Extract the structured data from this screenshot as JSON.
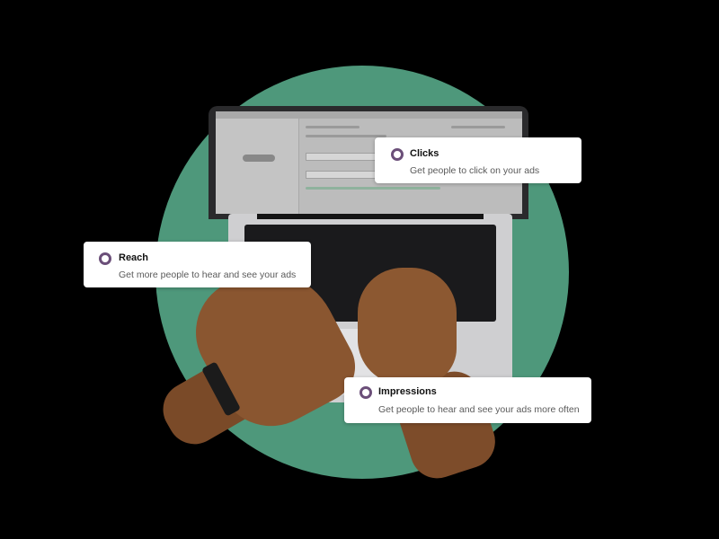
{
  "options": [
    {
      "title": "Clicks",
      "description": "Get people to click on your ads",
      "icon": "radio-button-icon"
    },
    {
      "title": "Reach",
      "description": "Get more people to hear and see your ads",
      "icon": "radio-button-icon"
    },
    {
      "title": "Impressions",
      "description": "Get people to hear and see your ads more often",
      "icon": "radio-button-icon"
    }
  ],
  "colors": {
    "background": "#000000",
    "circle": "#4e987b",
    "radio_accent": "#6b4f79",
    "card": "#ffffff"
  }
}
